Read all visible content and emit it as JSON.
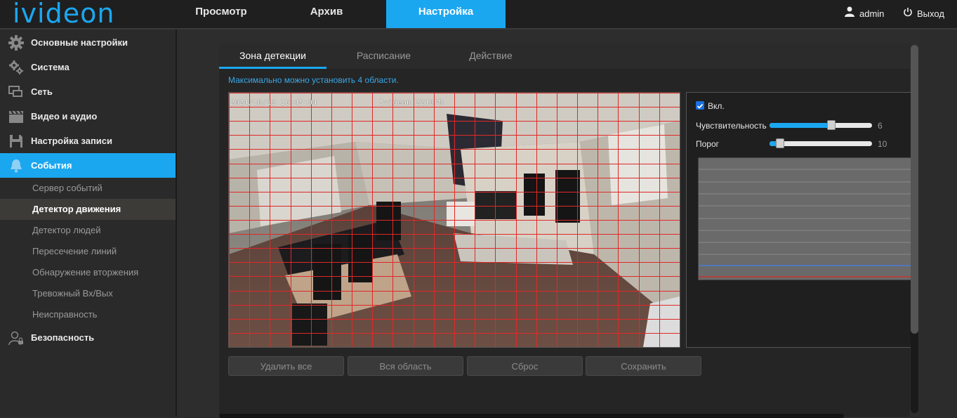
{
  "app": {
    "logo": "ivideon"
  },
  "nav": {
    "tabs": [
      {
        "label": "Просмотр"
      },
      {
        "label": "Архив"
      },
      {
        "label": "Настройка"
      }
    ],
    "user": "admin",
    "logout": "Выход"
  },
  "sidebar": {
    "items": [
      {
        "label": "Основные настройки",
        "icon": "gear-icon"
      },
      {
        "label": "Система",
        "icon": "gears-icon"
      },
      {
        "label": "Сеть",
        "icon": "network-icon"
      },
      {
        "label": "Видео и аудио",
        "icon": "clapperboard-icon"
      },
      {
        "label": "Настройка записи",
        "icon": "floppy-icon"
      },
      {
        "label": "События",
        "icon": "bell-icon"
      }
    ],
    "sub_items": [
      {
        "label": "Сервер событий"
      },
      {
        "label": "Детектор движения"
      },
      {
        "label": "Детектор людей"
      },
      {
        "label": "Пересечение линий"
      },
      {
        "label": "Обнаружение вторжения"
      },
      {
        "label": "Тревожный Вх/Вых"
      },
      {
        "label": "Неисправность"
      }
    ],
    "security": {
      "label": "Безопасность",
      "icon": "user-lock-icon"
    }
  },
  "main": {
    "tabs": [
      {
        "label": "Зона детекции"
      },
      {
        "label": "Расписание"
      },
      {
        "label": "Действие"
      }
    ],
    "hint": "Максимально можно установить 4 области.",
    "video": {
      "timestamp": "2024/10/13 16:45:04",
      "camera_name": "Ivideon 2210FM"
    },
    "settings": {
      "enabled_label": "Вкл.",
      "enabled": true,
      "sensitivity_label": "Чувствительность",
      "sensitivity_value": "6",
      "sensitivity_fraction": 0.6,
      "threshold_label": "Порог",
      "threshold_value": "10",
      "threshold_fraction": 0.1
    },
    "buttons": {
      "delete_all": "Удалить все",
      "whole_area": "Вся область",
      "reset": "Сброс",
      "save": "Сохранить"
    }
  },
  "colors": {
    "accent": "#1ba7f0",
    "grid": "#e02828",
    "graph_line_blue": "#4a7ad8",
    "graph_line_red": "#c83232"
  }
}
